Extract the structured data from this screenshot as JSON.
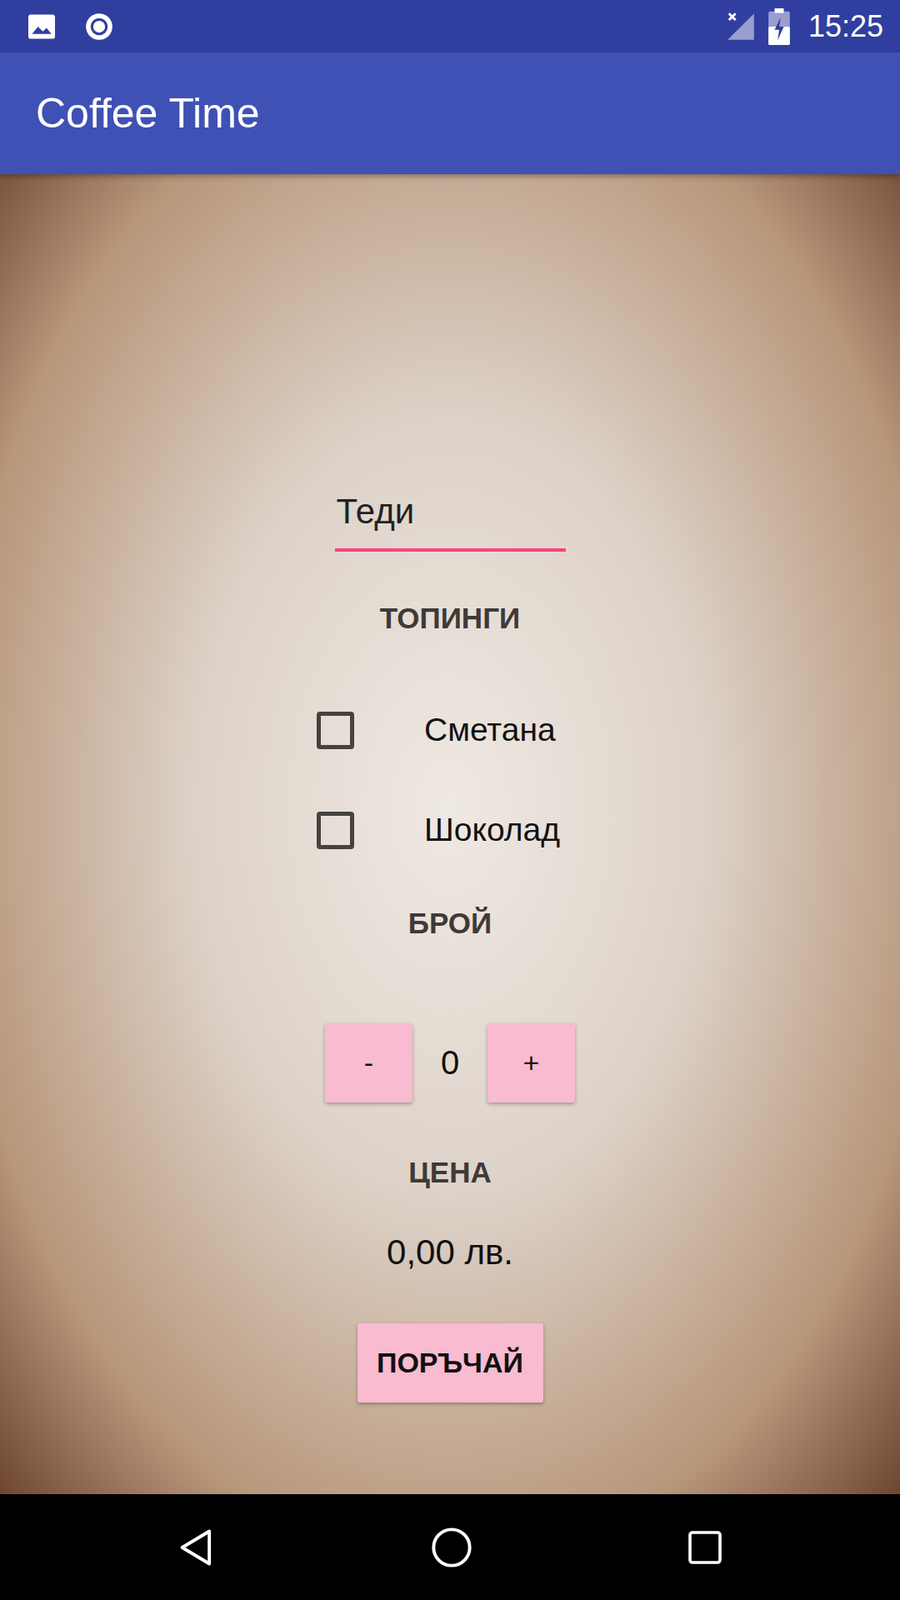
{
  "status_bar": {
    "time": "15:25"
  },
  "app_bar": {
    "title": "Coffee Time"
  },
  "name_field": {
    "value": "Теди",
    "focused": true
  },
  "toppings": {
    "heading": "ТОПИНГИ",
    "items": [
      {
        "label": "Сметана",
        "checked": false
      },
      {
        "label": "Шоколад",
        "checked": false
      }
    ]
  },
  "quantity": {
    "heading": "БРОЙ",
    "decrement": "-",
    "value": "0",
    "increment": "+"
  },
  "price": {
    "heading": "ЦЕНА",
    "value": "0,00 лв."
  },
  "order_button": {
    "label": "ПОРЪЧАЙ"
  }
}
